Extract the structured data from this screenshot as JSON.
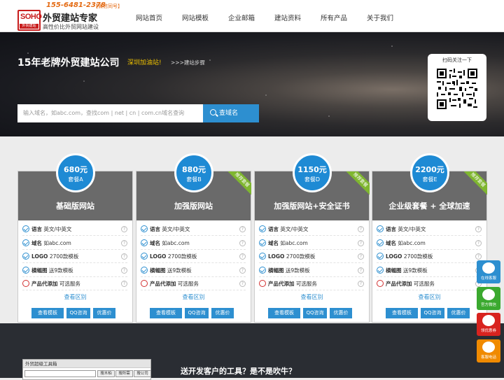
{
  "header": {
    "logo_text": "SOHO",
    "logo_sub": "外贸建站",
    "phone": "155-6481-2378",
    "wechat_tag": "【微信同号】",
    "brand_title": "外贸建站专家",
    "brand_sub": "高性价比外贸网站建设",
    "nav": [
      "网站首页",
      "网站模板",
      "企业邮箱",
      "建站资料",
      "所有产品",
      "关于我们"
    ]
  },
  "hero": {
    "title": "15年老牌外贸建站公司",
    "slogan": "深圳加油站!",
    "steps_link": ">>>建站步骤",
    "search_placeholder": "输入域名，如abc.com，查找com | net | cn | com.cn域名查询",
    "search_button": "查域名",
    "qr_title": "扫码关注一下"
  },
  "plans": [
    {
      "price": "680元",
      "plan": "套餐A",
      "name": "基础版网站",
      "ribbon": "",
      "features": [
        {
          "k": "语言",
          "v": "英文/中英文",
          "ok": true
        },
        {
          "k": "域名",
          "v": "如abc.com",
          "ok": true
        },
        {
          "k": "LOGO",
          "v": "2700款模板",
          "ok": true
        },
        {
          "k": "横幅图",
          "v": "送9款模板",
          "ok": true
        },
        {
          "k": "产品代添加",
          "v": "可选服务",
          "ok": false
        }
      ]
    },
    {
      "price": "880元",
      "plan": "套餐B",
      "name": "加强版网站",
      "ribbon": "推荐套餐",
      "features": [
        {
          "k": "语言",
          "v": "英文/中英文",
          "ok": true
        },
        {
          "k": "域名",
          "v": "如abc.com",
          "ok": true
        },
        {
          "k": "LOGO",
          "v": "2700款模板",
          "ok": true
        },
        {
          "k": "横幅图",
          "v": "送9款模板",
          "ok": true
        },
        {
          "k": "产品代添加",
          "v": "可选服务",
          "ok": false
        }
      ]
    },
    {
      "price": "1150元",
      "plan": "套餐D",
      "name": "加强版网站+安全证书",
      "ribbon": "推荐套餐",
      "features": [
        {
          "k": "语言",
          "v": "英文/中英文",
          "ok": true
        },
        {
          "k": "域名",
          "v": "如abc.com",
          "ok": true
        },
        {
          "k": "LOGO",
          "v": "2700款模板",
          "ok": true
        },
        {
          "k": "横幅图",
          "v": "送9款模板",
          "ok": true
        },
        {
          "k": "产品代添加",
          "v": "可选服务",
          "ok": false
        }
      ]
    },
    {
      "price": "2200元",
      "plan": "套餐E",
      "name": "企业级套餐 + 全球加速",
      "ribbon": "推荐套餐",
      "features": [
        {
          "k": "语言",
          "v": "英文/中英文",
          "ok": true
        },
        {
          "k": "域名",
          "v": "如abc.com",
          "ok": true
        },
        {
          "k": "LOGO",
          "v": "2700款模板",
          "ok": true
        },
        {
          "k": "横幅图",
          "v": "送9款模板",
          "ok": true
        },
        {
          "k": "产品代添加",
          "v": "可选服务",
          "ok": false
        }
      ]
    }
  ],
  "plan_common": {
    "view_diff": "查看区别",
    "buttons": [
      "查看模板",
      "QQ咨询",
      "优惠价"
    ]
  },
  "bottom": {
    "tool_title": "外贸超级工具箱",
    "tool_buttons": [
      "搜木柏",
      "搜所需",
      "搜公司"
    ],
    "slogan": "送开发客户的工具？是不是吹牛？"
  },
  "side_tools": [
    {
      "label": "在线客服",
      "icon": "qq-icon",
      "color": "#2d8fd0"
    },
    {
      "label": "官方微信",
      "icon": "wechat-icon",
      "color": "#3ba92f"
    },
    {
      "label": "领优惠券",
      "icon": "coupon-icon",
      "color": "#d8231f"
    },
    {
      "label": "客服电话",
      "icon": "phone-icon",
      "color": "#f08a00"
    }
  ],
  "colors": {
    "accent": "#2d8fd0",
    "phone": "#e46a12",
    "logo_red": "#c81d1d",
    "ribbon": "#7fb630"
  }
}
